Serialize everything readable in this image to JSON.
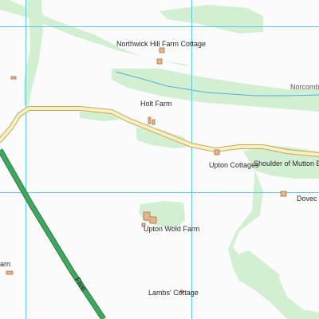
{
  "colors": {
    "background": "#fbfbfb",
    "woodland": "#d3efd2",
    "grid": "#5ac8e8",
    "road_casing": "#c8a85a",
    "road_fill": "#f6f0c4",
    "major_road": "#3fa75f",
    "major_road_edge": "#2e7d46",
    "stream": "#4ab3d8",
    "building": "#e8b48c",
    "building_edge": "#a0704c"
  },
  "labels": {
    "northwick": "Northwick Hill Farm Cottage",
    "holt_farm": "Holt Farm",
    "upton_cottages": "Upton Cottages",
    "shoulder_of_mutton": "Shoulder of Mutton Barn",
    "upton_wold": "Upton Wold Farm",
    "lambs_cottage": "Lambs' Cottage",
    "norcomb": "Norcomb",
    "dovec": "Dovec",
    "barn_partial": "arn",
    "five_road": "Five"
  }
}
